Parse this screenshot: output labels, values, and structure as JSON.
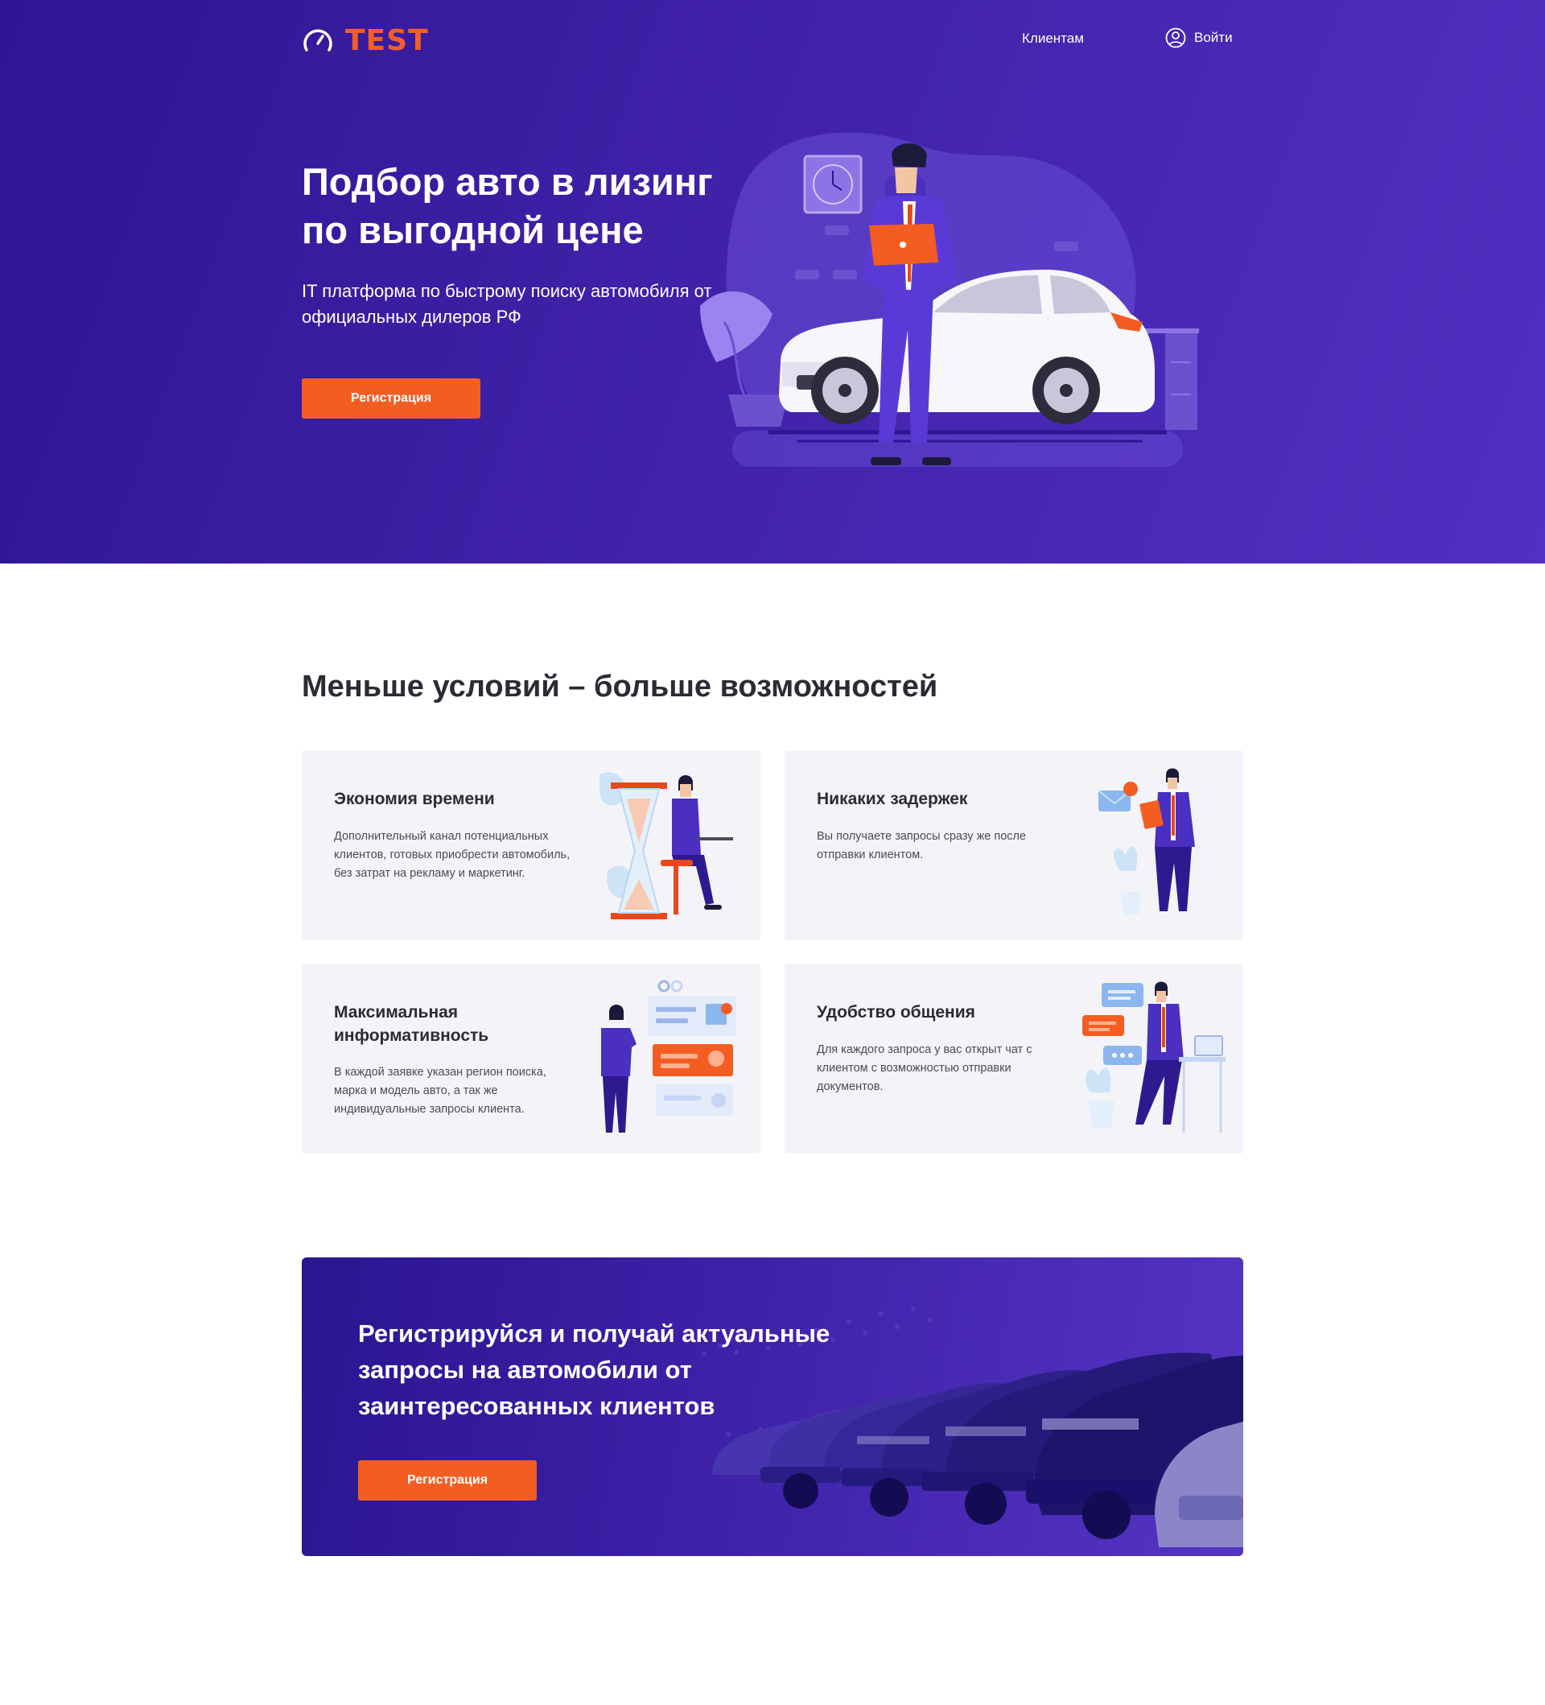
{
  "header": {
    "logo_text": "TEST",
    "nav_clients": "Клиентам",
    "nav_login": "Войти"
  },
  "hero": {
    "title": "Подбор авто в лизинг по выгодной цене",
    "subtitle": "IT платформа по быстрому поиску автомобиля от официальных дилеров РФ",
    "button_label": "Регистрация"
  },
  "features": {
    "title": "Меньше условий – больше возможностей",
    "cards": [
      {
        "title": "Экономия времени",
        "text": "Дополнительный канал потенциальных клиентов, готовых приобрести автомобиль, без затрат на рекламу и маркетинг.",
        "icon": "hourglass-businessman-illustration"
      },
      {
        "title": "Никаких задержек",
        "text": "Вы получаете запросы сразу же после отправки клиентом.",
        "icon": "notification-businessman-illustration"
      },
      {
        "title": "Максимальная информативность",
        "text": "В каждой заявке указан регион поиска, марка и модель авто, а так же индивидуальные запросы клиента.",
        "icon": "profile-cards-illustration"
      },
      {
        "title": "Удобство общения",
        "text": "Для каждого запроса у вас открыт чат с клиентом с возможностью отправки документов.",
        "icon": "chat-bubbles-illustration"
      }
    ]
  },
  "cta": {
    "title": "Регистрируйся и получай актуальные запросы на автомобили от заинтересованных клиентов",
    "button_label": "Регистрация"
  },
  "colors": {
    "accent": "#f45d22",
    "brand_purple": "#3f22a8",
    "card_bg": "#f4f4f8"
  }
}
